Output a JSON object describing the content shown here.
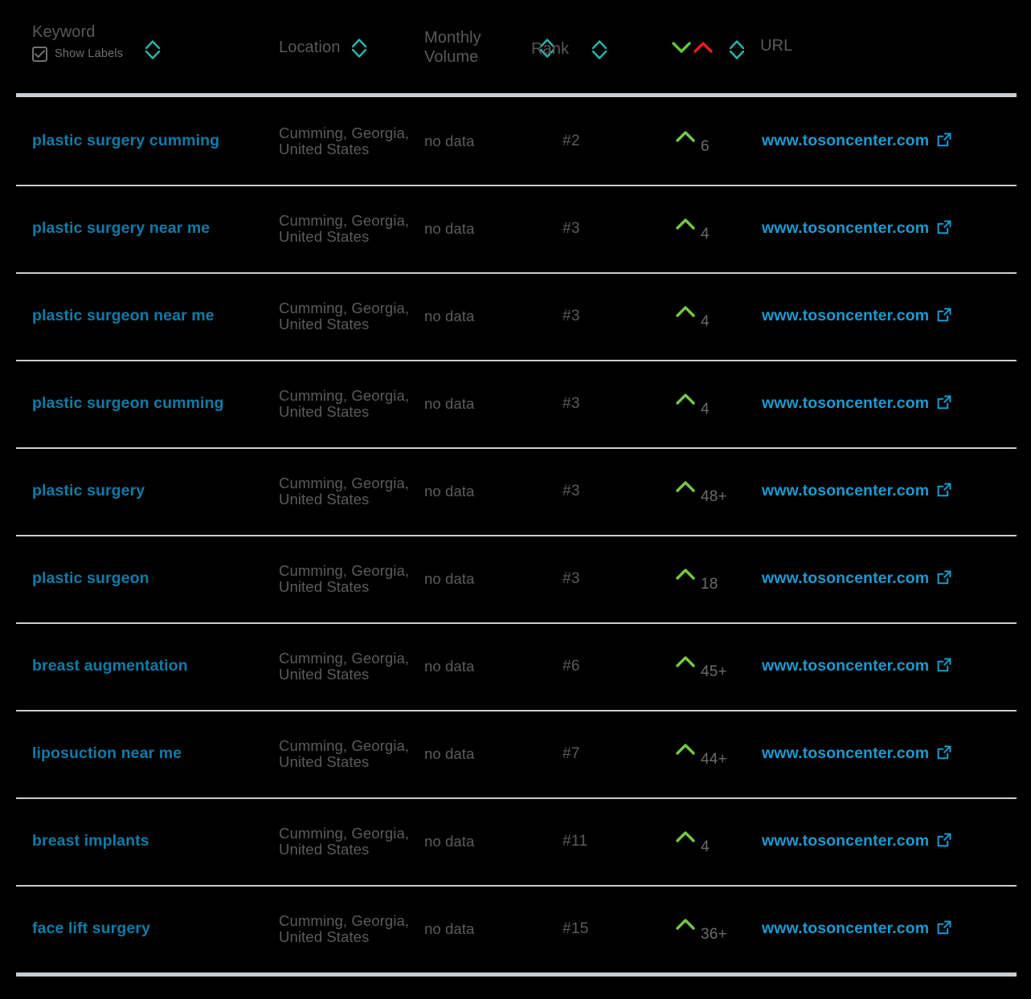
{
  "colors": {
    "background": "#000000",
    "keyword_link": "#0d7ca9",
    "url_link": "#1a9ad1",
    "muted_text": "#5a5b5d",
    "header_text": "#59595b",
    "divider": "#c8ced1",
    "sort_icon": "#2bb5ab",
    "up_green": "#76c943",
    "down_red": "#f01c22"
  },
  "header": {
    "keyword": {
      "label": "Keyword",
      "show_labels_label": "Show Labels",
      "show_labels_checked": true,
      "sort_icon": "sort-diamond-icon"
    },
    "location": {
      "label": "Location",
      "sort_icon": "sort-diamond-icon"
    },
    "monthly_volume": {
      "label": "Monthly\nVolume",
      "sort_icon": "sort-diamond-icon"
    },
    "rank": {
      "label": "Rank",
      "sort_icon": "sort-diamond-icon"
    },
    "change": {
      "label": "",
      "down_icon": "chevron-down-green-icon",
      "up_icon": "chevron-up-red-icon",
      "sort_icon": "sort-diamond-icon"
    },
    "url": {
      "label": "URL"
    }
  },
  "rows": [
    {
      "keyword": "plastic surgery cumming",
      "location": "Cumming, Georgia, United States",
      "monthly_volume": "no data",
      "rank": "#2",
      "change_direction": "up",
      "change_value": "6",
      "url": "www.tosoncenter.com"
    },
    {
      "keyword": "plastic surgery near me",
      "location": "Cumming, Georgia, United States",
      "monthly_volume": "no data",
      "rank": "#3",
      "change_direction": "up",
      "change_value": "4",
      "url": "www.tosoncenter.com"
    },
    {
      "keyword": "plastic surgeon near me",
      "location": "Cumming, Georgia, United States",
      "monthly_volume": "no data",
      "rank": "#3",
      "change_direction": "up",
      "change_value": "4",
      "url": "www.tosoncenter.com"
    },
    {
      "keyword": "plastic surgeon cumming",
      "location": "Cumming, Georgia, United States",
      "monthly_volume": "no data",
      "rank": "#3",
      "change_direction": "up",
      "change_value": "4",
      "url": "www.tosoncenter.com"
    },
    {
      "keyword": "plastic surgery",
      "location": "Cumming, Georgia, United States",
      "monthly_volume": "no data",
      "rank": "#3",
      "change_direction": "up",
      "change_value": "48+",
      "url": "www.tosoncenter.com"
    },
    {
      "keyword": "plastic surgeon",
      "location": "Cumming, Georgia, United States",
      "monthly_volume": "no data",
      "rank": "#3",
      "change_direction": "up",
      "change_value": "18",
      "url": "www.tosoncenter.com"
    },
    {
      "keyword": "breast augmentation",
      "location": "Cumming, Georgia, United States",
      "monthly_volume": "no data",
      "rank": "#6",
      "change_direction": "up",
      "change_value": "45+",
      "url": "www.tosoncenter.com"
    },
    {
      "keyword": "liposuction near me",
      "location": "Cumming, Georgia, United States",
      "monthly_volume": "no data",
      "rank": "#7",
      "change_direction": "up",
      "change_value": "44+",
      "url": "www.tosoncenter.com"
    },
    {
      "keyword": "breast implants",
      "location": "Cumming, Georgia, United States",
      "monthly_volume": "no data",
      "rank": "#11",
      "change_direction": "up",
      "change_value": "4",
      "url": "www.tosoncenter.com"
    },
    {
      "keyword": "face lift surgery",
      "location": "Cumming, Georgia, United States",
      "monthly_volume": "no data",
      "rank": "#15",
      "change_direction": "up",
      "change_value": "36+",
      "url": "www.tosoncenter.com"
    }
  ]
}
